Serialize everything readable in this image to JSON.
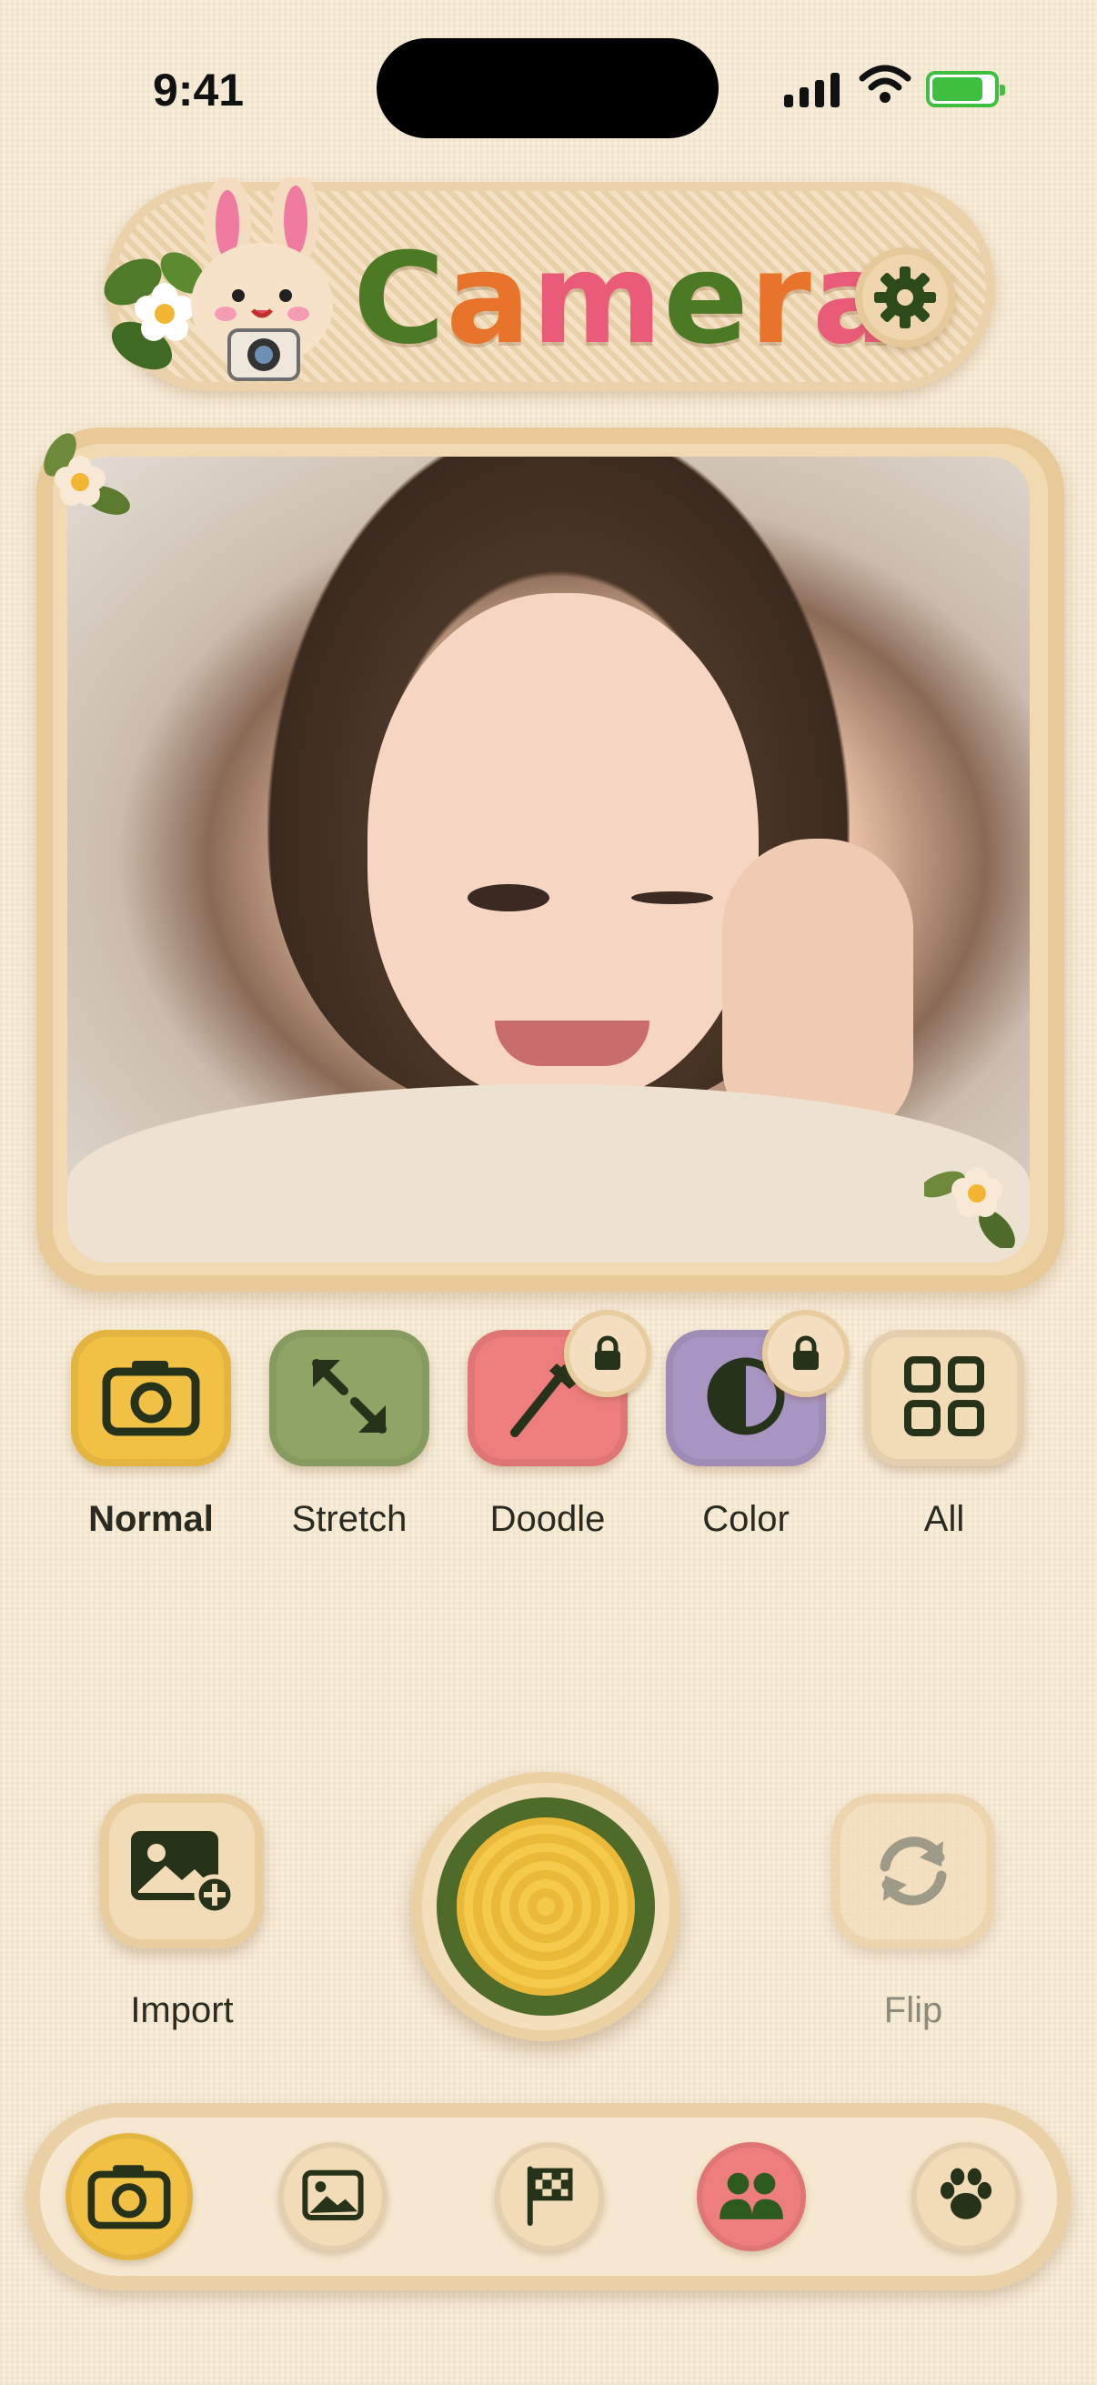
{
  "status_bar": {
    "time": "9:41"
  },
  "header": {
    "title_letters": [
      {
        "ch": "C",
        "color": "#4c7a24"
      },
      {
        "ch": "a",
        "color": "#e8732b"
      },
      {
        "ch": "m",
        "color": "#ea5b7a"
      },
      {
        "ch": "e",
        "color": "#4c7a24"
      },
      {
        "ch": "r",
        "color": "#e8732b"
      },
      {
        "ch": "a",
        "color": "#ea5b7a"
      }
    ]
  },
  "modes": [
    {
      "label": "Normal",
      "color": "#f2c144",
      "icon": "camera-icon",
      "selected": true,
      "locked": false
    },
    {
      "label": "Stretch",
      "color": "#8fa565",
      "icon": "expand-arrows-icon",
      "selected": false,
      "locked": false
    },
    {
      "label": "Doodle",
      "color": "#ee7d7d",
      "icon": "pen-icon",
      "selected": false,
      "locked": true
    },
    {
      "label": "Color",
      "color": "#a895c2",
      "icon": "half-circle-icon",
      "selected": false,
      "locked": true
    },
    {
      "label": "All",
      "color": "#f2dcb8",
      "icon": "grid-icon",
      "selected": false,
      "locked": false
    }
  ],
  "actions": {
    "import_label": "Import",
    "flip_label": "Flip"
  },
  "tabs": [
    {
      "icon": "camera-icon",
      "color": "#f2c144",
      "active": true
    },
    {
      "icon": "gallery-icon",
      "color": "#f2dcb8",
      "active": false
    },
    {
      "icon": "flag-icon",
      "color": "#f2dcb8",
      "active": false
    },
    {
      "icon": "people-icon",
      "color": "#ee7d7d",
      "active": false
    },
    {
      "icon": "paw-icon",
      "color": "#f2dcb8",
      "active": false
    }
  ],
  "colors": {
    "ink": "#26331a",
    "accent_green": "#4f6b2a",
    "accent_yellow": "#f2c144"
  }
}
